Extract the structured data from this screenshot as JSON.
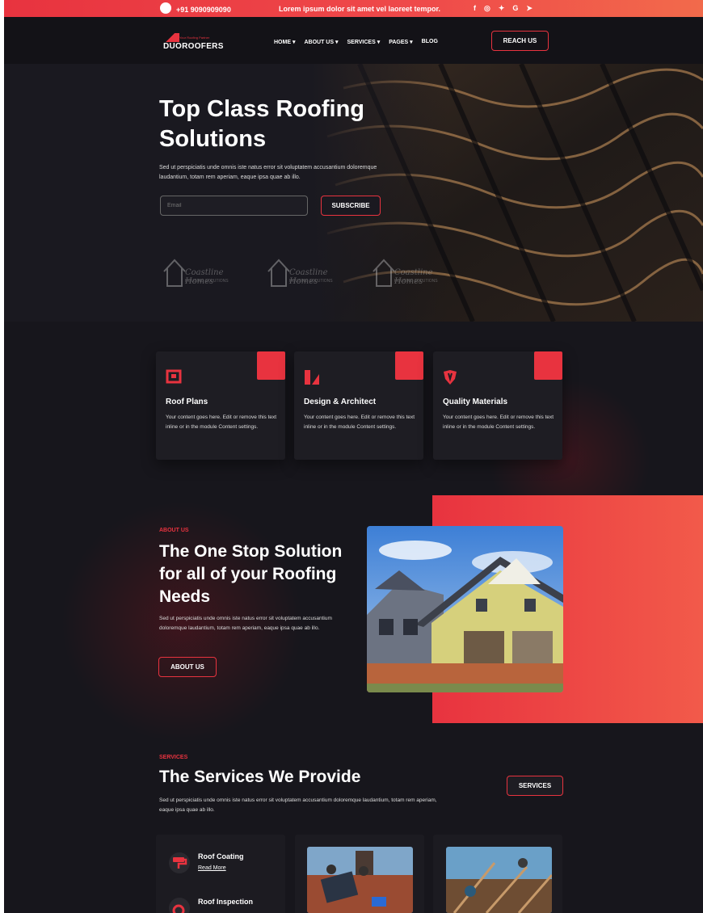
{
  "topbar": {
    "phone": "+91 9090909090",
    "message": "Lorem ipsum dolor sit amet vel laoreet tempor.",
    "socials": [
      "facebook-icon",
      "instagram-icon",
      "twitter-icon",
      "google-icon",
      "telegram-icon"
    ]
  },
  "nav": {
    "logo_small": "Your Roofing Partner",
    "logo_name": "DUOROOFERS",
    "items": [
      "HOME ▾",
      "ABOUT US ▾",
      "SERVICES ▾",
      "PAGES ▾",
      "BLOG"
    ],
    "cta": "REACH US"
  },
  "hero": {
    "title": "Top Class Roofing Solutions",
    "text": "Sed ut perspiciatis unde omnis iste natus error sit voluptatem accusantium doloremque laudantium, totam rem aperiam, eaque ipsa quae ab illo.",
    "email_placeholder": "Email",
    "subscribe": "SUBSCRIBE",
    "client_logos": [
      {
        "name": "Coastline Homes",
        "tagline": "HOUSING SOLUTIONS"
      },
      {
        "name": "Coastline Homes",
        "tagline": "HOUSING SOLUTIONS"
      },
      {
        "name": "Coastline Homes",
        "tagline": "HOUSING SOLUTIONS"
      }
    ]
  },
  "features": [
    {
      "icon": "blueprint-icon",
      "title": "Roof Plans",
      "text": "Your content goes here. Edit or remove this text inline or in the module Content settings."
    },
    {
      "icon": "design-tools-icon",
      "title": "Design & Architect",
      "text": "Your content goes here. Edit or remove this text inline or in the module Content settings."
    },
    {
      "icon": "shield-icon",
      "title": "Quality Materials",
      "text": "Your content goes here. Edit or remove this text inline or in the module Content settings."
    }
  ],
  "about": {
    "eyebrow": "ABOUT US",
    "title": "The One Stop Solution for all of your Roofing Needs",
    "text": "Sed ut perspiciatis unde omnis iste natus error sit voluptatem accusantium doloremque laudantium, totam rem aperiam, eaque ipsa quae ab illo.",
    "button": "ABOUT US"
  },
  "services": {
    "eyebrow": "SERVICES",
    "title": "The Services We Provide",
    "text": "Sed ut perspiciatis unde omnis iste natus error sit voluptatem accusantium doloremque laudantium, totam rem aperiam, eaque ipsa quae ab illo.",
    "button": "SERVICES",
    "list": [
      {
        "label": "Roof Coating",
        "link": "Read More"
      },
      {
        "label": "Roof Inspection",
        "link": ""
      }
    ]
  },
  "colors": {
    "accent": "#e8333f",
    "accent2": "#f26a4b",
    "bg": "#17161c",
    "card": "#1e1d23"
  }
}
